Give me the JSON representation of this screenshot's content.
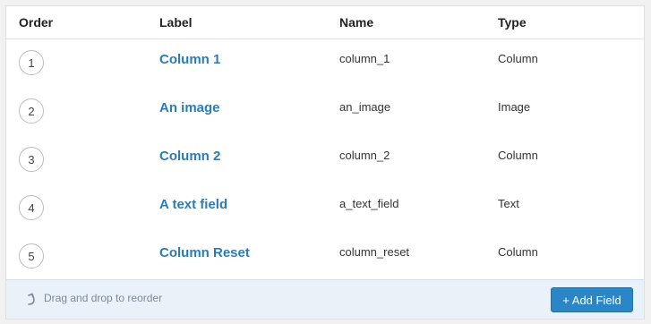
{
  "table": {
    "columns": {
      "order": "Order",
      "label": "Label",
      "name": "Name",
      "type": "Type"
    },
    "rows": [
      {
        "order": "1",
        "label": "Column 1",
        "name": "column_1",
        "type": "Column"
      },
      {
        "order": "2",
        "label": "An image",
        "name": "an_image",
        "type": "Image"
      },
      {
        "order": "3",
        "label": "Column 2",
        "name": "column_2",
        "type": "Column"
      },
      {
        "order": "4",
        "label": "A text field",
        "name": "a_text_field",
        "type": "Text"
      },
      {
        "order": "5",
        "label": "Column Reset",
        "name": "column_reset",
        "type": "Column"
      }
    ]
  },
  "footer": {
    "hint_text": "Drag and drop to reorder",
    "hint_icon": "curved-arrow-up-icon",
    "add_button_label": "+ Add Field"
  },
  "colors": {
    "link": "#2b7bb9",
    "button": "#2b86c7",
    "footer_bg": "#e9f1f9"
  }
}
